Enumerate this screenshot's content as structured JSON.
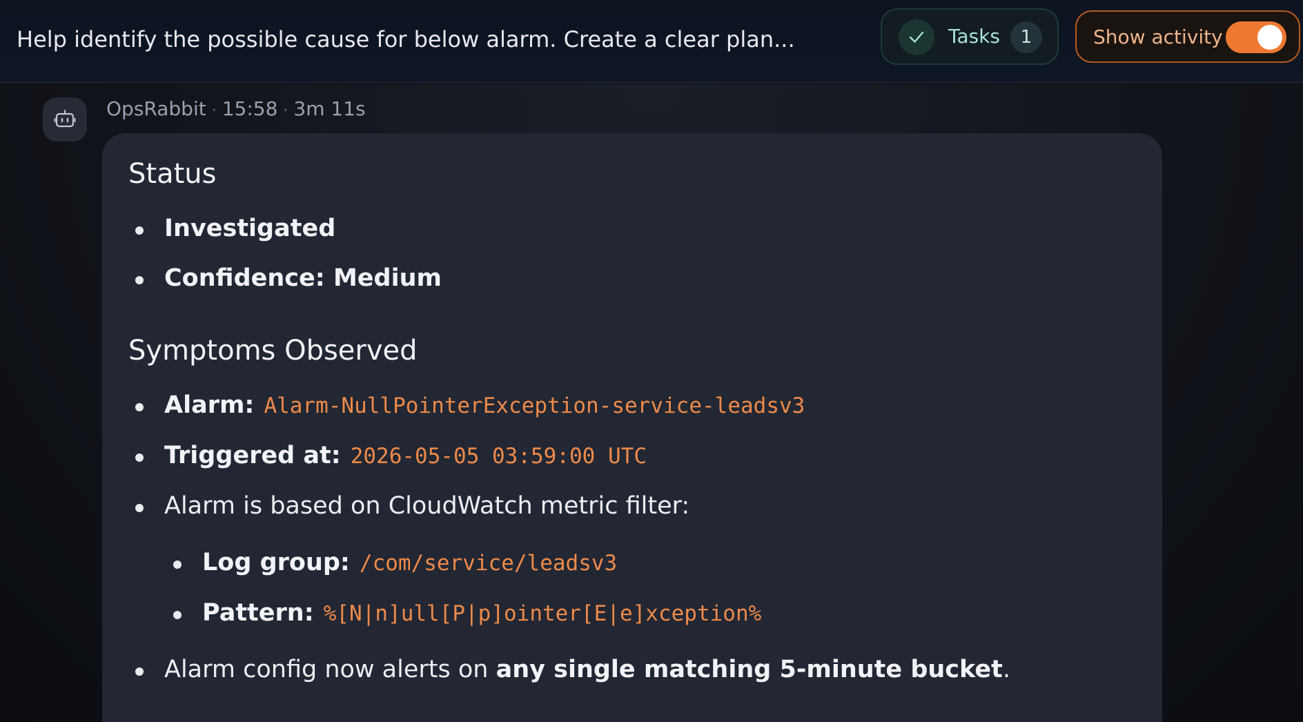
{
  "header": {
    "title": "Help identify the possible cause for below alarm. Create a clear plan...",
    "tasks_label": "Tasks",
    "tasks_count": "1",
    "show_activity_label": "Show activity",
    "show_activity_on": true,
    "accent_color": "#ee7a32",
    "tasks_accent_color": "#a9e3d6",
    "check_icon": "check-icon"
  },
  "message": {
    "author": "OpsRabbit",
    "time": "15:58",
    "duration": "3m 11s",
    "avatar_icon": "robot-icon",
    "sections": {
      "status": {
        "heading": "Status",
        "items": [
          "Investigated",
          "Confidence: Medium"
        ]
      },
      "symptoms": {
        "heading": "Symptoms Observed",
        "alarm_label": "Alarm:",
        "alarm_value": "Alarm-NullPointerException-service-leadsv3",
        "triggered_label": "Triggered at:",
        "triggered_value": "2026-05-05 03:59:00 UTC",
        "metric_filter_text": "Alarm is based on CloudWatch metric filter:",
        "log_group_label": "Log group:",
        "log_group_value": "/com/service/leadsv3",
        "pattern_label": "Pattern:",
        "pattern_value": "%[N|n]ull[P|p]ointer[E|e]xception%",
        "config_prefix": "Alarm config now alerts on ",
        "config_bold": "any single matching 5-minute bucket",
        "config_suffix": "."
      }
    },
    "code_color": "#ee8a4a"
  }
}
